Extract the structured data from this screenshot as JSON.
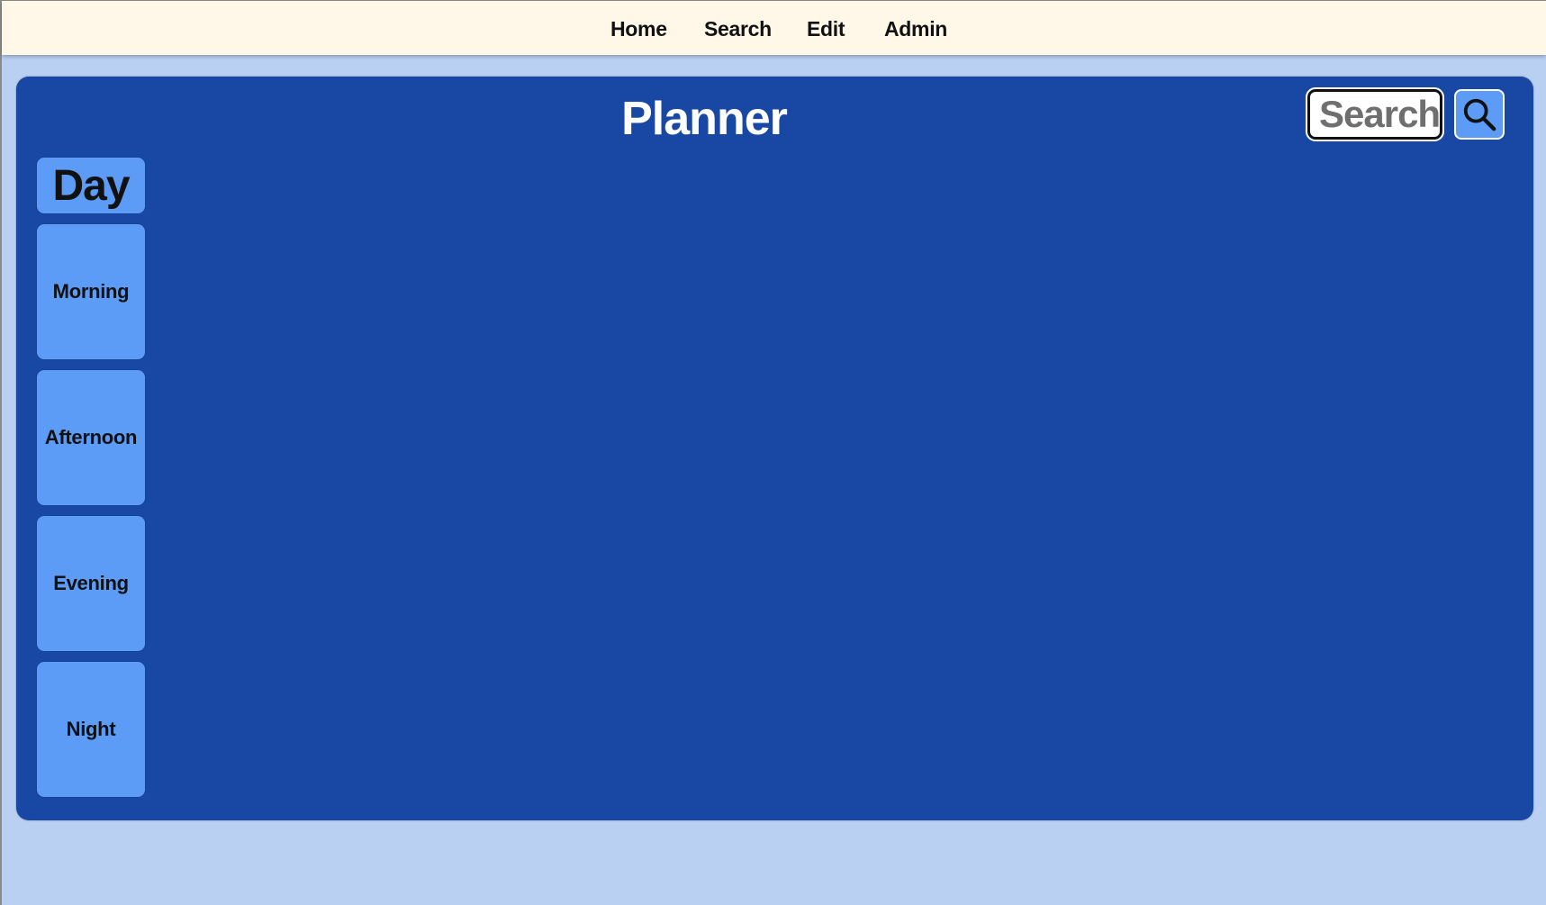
{
  "nav": {
    "items": [
      {
        "label": "Home"
      },
      {
        "label": "Search"
      },
      {
        "label": "Edit"
      },
      {
        "label": "Admin"
      }
    ]
  },
  "planner": {
    "title": "Planner",
    "search": {
      "placeholder": "Search",
      "button_icon": "search-icon"
    },
    "column_header": "Day",
    "slots": [
      {
        "label": "Morning"
      },
      {
        "label": "Afternoon"
      },
      {
        "label": "Evening"
      },
      {
        "label": "Night"
      }
    ]
  },
  "colors": {
    "page_background": "#bad0f3",
    "nav_background": "#fff8e8",
    "panel_background": "#1848a4",
    "slot_background": "#5d9cf6",
    "text_dark": "#111111",
    "title_text": "#ffffff"
  }
}
